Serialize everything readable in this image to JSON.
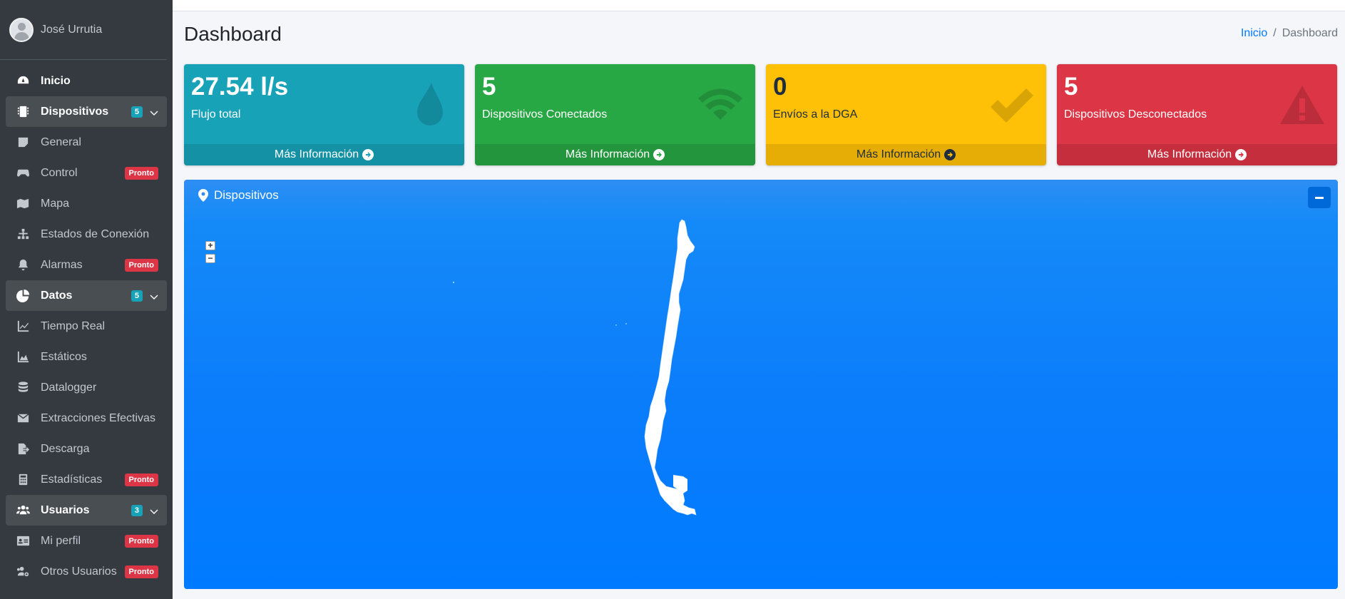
{
  "user": {
    "name": "José Urrutia"
  },
  "sidebar": {
    "items": [
      {
        "label": "Inicio",
        "icon": "dashboard-icon",
        "type": "top"
      },
      {
        "label": "Dispositivos",
        "icon": "microchip-icon",
        "type": "header",
        "count": "5"
      },
      {
        "label": "General",
        "icon": "sticky-note-icon"
      },
      {
        "label": "Control",
        "icon": "gamepad-icon",
        "badge": "Pronto"
      },
      {
        "label": "Mapa",
        "icon": "map-icon"
      },
      {
        "label": "Estados de Conexión",
        "icon": "sitemap-icon"
      },
      {
        "label": "Alarmas",
        "icon": "bell-icon",
        "badge": "Pronto"
      },
      {
        "label": "Datos",
        "icon": "pie-chart-icon",
        "type": "header",
        "count": "5"
      },
      {
        "label": "Tiempo Real",
        "icon": "line-chart-icon"
      },
      {
        "label": "Estáticos",
        "icon": "area-chart-icon"
      },
      {
        "label": "Datalogger",
        "icon": "database-icon"
      },
      {
        "label": "Extracciones Efectivas",
        "icon": "envelope-icon"
      },
      {
        "label": "Descarga",
        "icon": "file-export-icon"
      },
      {
        "label": "Estadísticas",
        "icon": "calculator-icon",
        "badge": "Pronto"
      },
      {
        "label": "Usuarios",
        "icon": "users-icon",
        "type": "header",
        "count": "3"
      },
      {
        "label": "Mi perfil",
        "icon": "id-card-icon",
        "badge": "Pronto"
      },
      {
        "label": "Otros Usuarios",
        "icon": "users-cog-icon",
        "badge": "Pronto"
      }
    ]
  },
  "header": {
    "title": "Dashboard",
    "breadcrumb": {
      "home": "Inicio",
      "separator": "/",
      "current": "Dashboard"
    }
  },
  "boxes": [
    {
      "value": "27.54 l/s",
      "label": "Flujo total",
      "footer": "Más Información",
      "color": "#17a2b8",
      "icon": "tint-icon"
    },
    {
      "value": "5",
      "label": "Dispositivos Conectados",
      "footer": "Más Información",
      "color": "#28a745",
      "icon": "wifi-icon"
    },
    {
      "value": "0",
      "label": "Envíos a la DGA",
      "footer": "Más Información",
      "color": "#ffc107",
      "icon": "check-icon"
    },
    {
      "value": "5",
      "label": "Dispositivos Desconectados",
      "footer": "Más Información",
      "color": "#dc3545",
      "icon": "warning-icon"
    }
  ],
  "map_card": {
    "title": "Dispositivos",
    "zoom_in": "+",
    "zoom_out": "−",
    "color": "#007bff"
  }
}
